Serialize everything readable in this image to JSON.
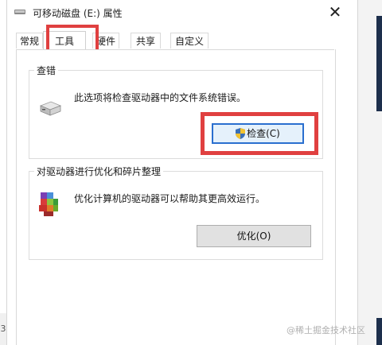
{
  "window": {
    "title": "可移动磁盘 (E:) 属性",
    "close_symbol": "✕"
  },
  "tabs": [
    {
      "label": "常规",
      "active": false
    },
    {
      "label": "工具",
      "active": true
    },
    {
      "label": "硬件",
      "active": false
    },
    {
      "label": "共享",
      "active": false
    },
    {
      "label": "自定义",
      "active": false
    }
  ],
  "error_check": {
    "group_title": "查错",
    "description": "此选项将检查驱动器中的文件系统错误。",
    "button_label": "检查(C)",
    "icon": "drive-icon"
  },
  "optimize": {
    "group_title": "对驱动器进行优化和碎片整理",
    "description": "优化计算机的驱动器可以帮助其更高效运行。",
    "button_label": "优化(O)",
    "icon": "defrag-icon"
  },
  "left_edge_text": "3",
  "watermark": "@稀土掘金技术社区",
  "colors": {
    "highlight": "#e04040",
    "focus_border": "#2a6fcf"
  }
}
